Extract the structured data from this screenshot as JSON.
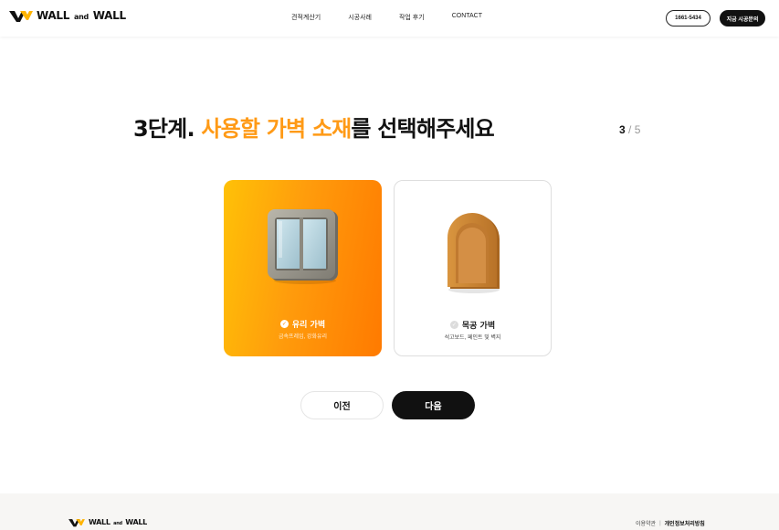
{
  "header": {
    "logo": {
      "word1": "WALL",
      "and": "and",
      "word2": "WALL"
    },
    "nav": [
      "견적계산기",
      "시공사례",
      "작업 후기",
      "CONTACT"
    ],
    "phone_button": "1661-5434",
    "inquiry_button": "지금 시공문의"
  },
  "main": {
    "title_prefix": "3단계. ",
    "title_highlight": "사용할 가벽 소재",
    "title_suffix": "를 선택해주세요",
    "step_current": "3",
    "step_sep": " / ",
    "step_total": "5",
    "options": [
      {
        "label": "유리 가벽",
        "description": "금속프레임, 강화유리",
        "selected": true
      },
      {
        "label": "목공 가벽",
        "description": "석고보드, 페인트 및 벽지",
        "selected": false
      }
    ],
    "prev_button": "이전",
    "next_button": "다음"
  },
  "footer": {
    "logo": {
      "word1": "WALL",
      "and": "and",
      "word2": "WALL"
    },
    "terms_link": "이용약관",
    "divider": "|",
    "privacy_link": "개인정보처리방침"
  },
  "colors": {
    "accent": "#ff9a16",
    "card_gradient_start": "#ffc107",
    "card_gradient_end": "#ff7a00",
    "button_dark": "#111111"
  },
  "icons": {
    "logo": "wall-logo-icon",
    "selected": "check-circle-icon",
    "unselected": "check-circle-outline-icon",
    "glass": "glass-window-icon",
    "wood": "wooden-arch-icon"
  }
}
